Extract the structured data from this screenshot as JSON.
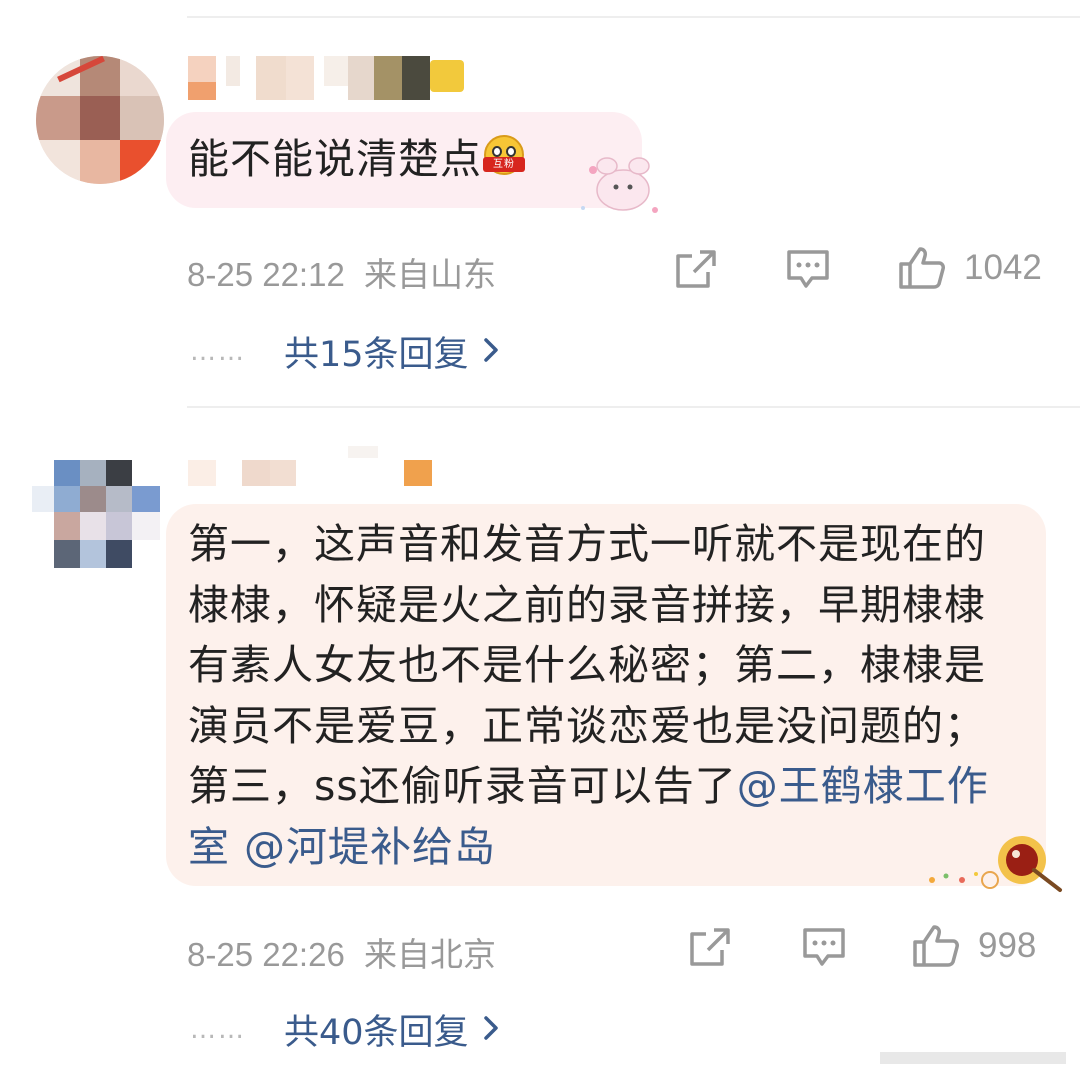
{
  "comments": [
    {
      "text": "能不能说清楚点",
      "emoji": {
        "name": "hugging-face-emoji",
        "tag": "互粉"
      },
      "timestamp": "8-25 22:12",
      "location": "来自山东",
      "likes": "1042",
      "replies_label": "共15条回复",
      "dots": "……"
    },
    {
      "text_plain": "第一，这声音和发音方式一听就不是现在的棣棣，怀疑是火之前的录音拼接，早期棣棣有素人女友也不是什么秘密；第二，棣棣是演员不是爱豆，正常谈恋爱也是没问题的；第三，ss还偷听录音可以告了",
      "mentions": [
        "@王鹤棣工作室",
        "@河堤补给岛"
      ],
      "timestamp": "8-25 22:26",
      "location": "来自北京",
      "likes": "998",
      "replies_label": "共40条回复",
      "dots": "……"
    }
  ],
  "icons": {
    "share": "share-icon",
    "comment": "comment-icon",
    "like": "thumbs-up-icon",
    "chevron": "chevron-right-icon"
  },
  "colors": {
    "link": "#3a5b8c",
    "meta": "#999999",
    "bubble1": "#fdeef2",
    "bubble2": "#fdf1ec"
  }
}
